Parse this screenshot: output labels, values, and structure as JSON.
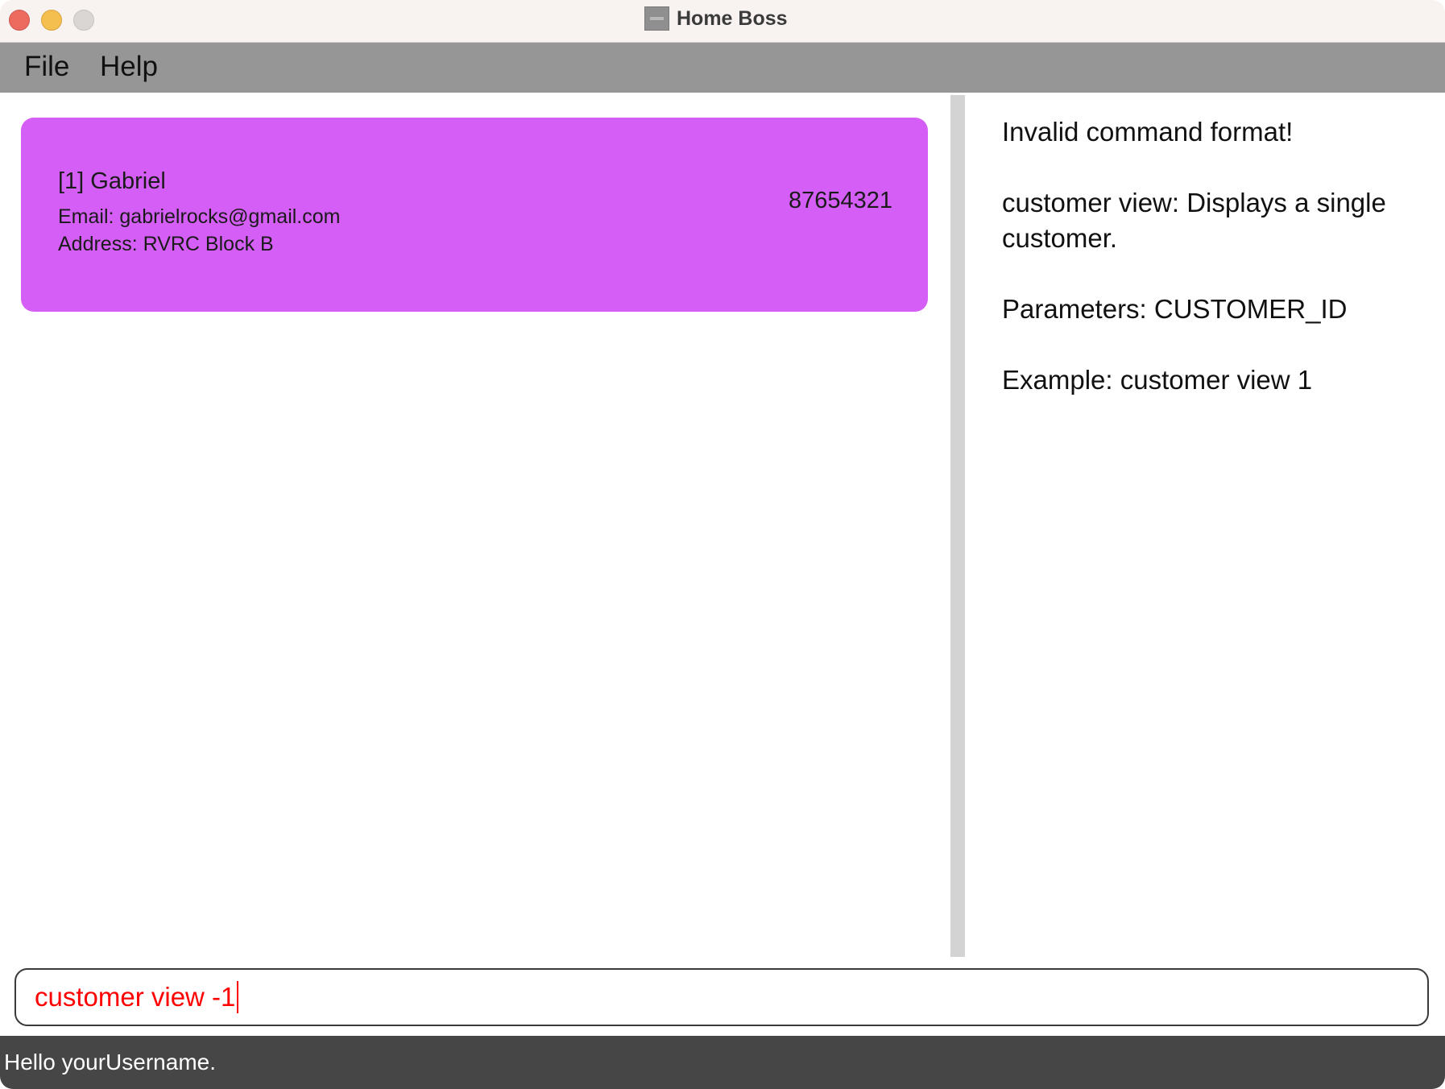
{
  "window": {
    "title": "Home Boss"
  },
  "menubar": {
    "file_label": "File",
    "help_label": "Help"
  },
  "customer_list": {
    "items": [
      {
        "name": "[1] Gabriel",
        "email": "Email: gabrielrocks@gmail.com",
        "address": "Address: RVRC Block B",
        "phone": "87654321"
      }
    ]
  },
  "result_display": {
    "text": "Invalid command format!\n\ncustomer view: Displays a single customer.\n\nParameters: CUSTOMER_ID\n\nExample: customer view 1"
  },
  "command_box": {
    "value": "customer view -1"
  },
  "status_bar": {
    "text": "Hello yourUsername."
  },
  "colors": {
    "card_background": "#d55ff6",
    "command_error_text": "#ff0000",
    "menubar_background": "#969696",
    "statusbar_background": "#464646"
  }
}
